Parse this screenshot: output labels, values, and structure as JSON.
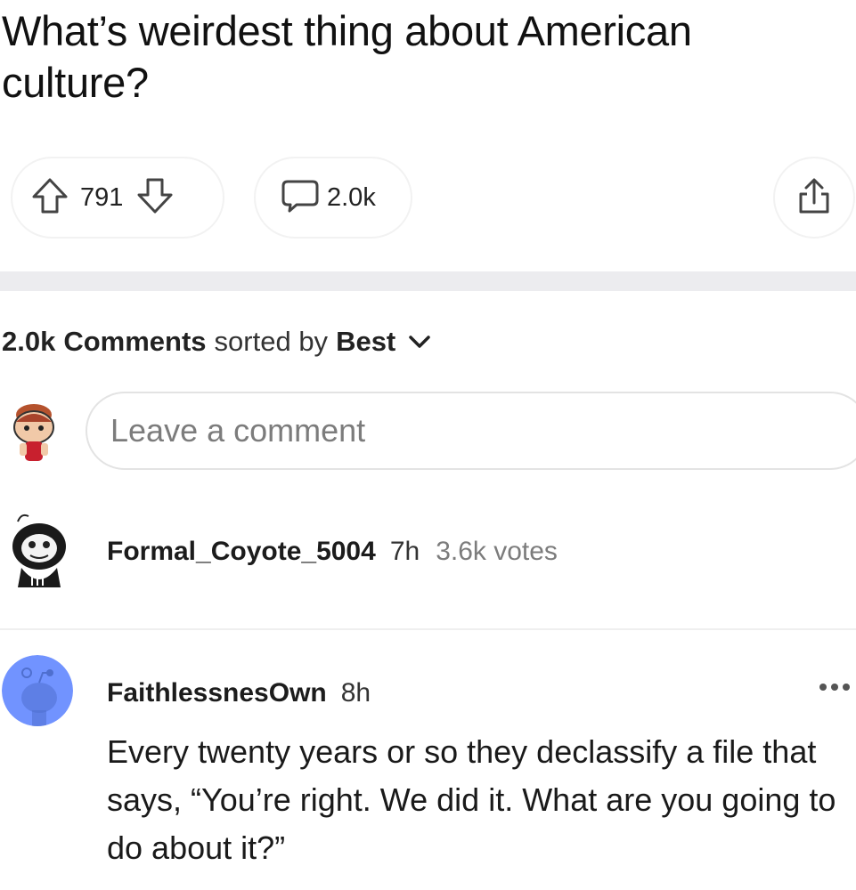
{
  "post": {
    "title": "What’s weirdest thing about American culture?",
    "upvote_count": "791",
    "comment_count": "2.0k"
  },
  "comments_header": {
    "count": "2.0k",
    "comments_label": "Comments",
    "sorted_by_label": "sorted by",
    "sort_value": "Best"
  },
  "comment_input": {
    "placeholder": "Leave a comment"
  },
  "collapsed_comment": {
    "username": "Formal_Coyote_5004",
    "time": "7h",
    "votes": "3.6k votes"
  },
  "reply": {
    "username": "FaithlessnesOwn",
    "time": "8h",
    "body": "Every twenty years or so they declassify a file that says, “You’re right. We did it. What are you going to do about it?”"
  },
  "icons": {
    "upvote": "arrow-up-outline-icon",
    "downvote": "arrow-down-outline-icon",
    "comment": "speech-bubble-icon",
    "share": "share-upload-icon",
    "sort_chevron": "chevron-down-icon",
    "more": "ellipsis-icon"
  },
  "colors": {
    "band": "#ececef",
    "placeholder": "#7c7c7c",
    "muted": "#7c7c7c",
    "avatar_blue": "#7193ff"
  }
}
